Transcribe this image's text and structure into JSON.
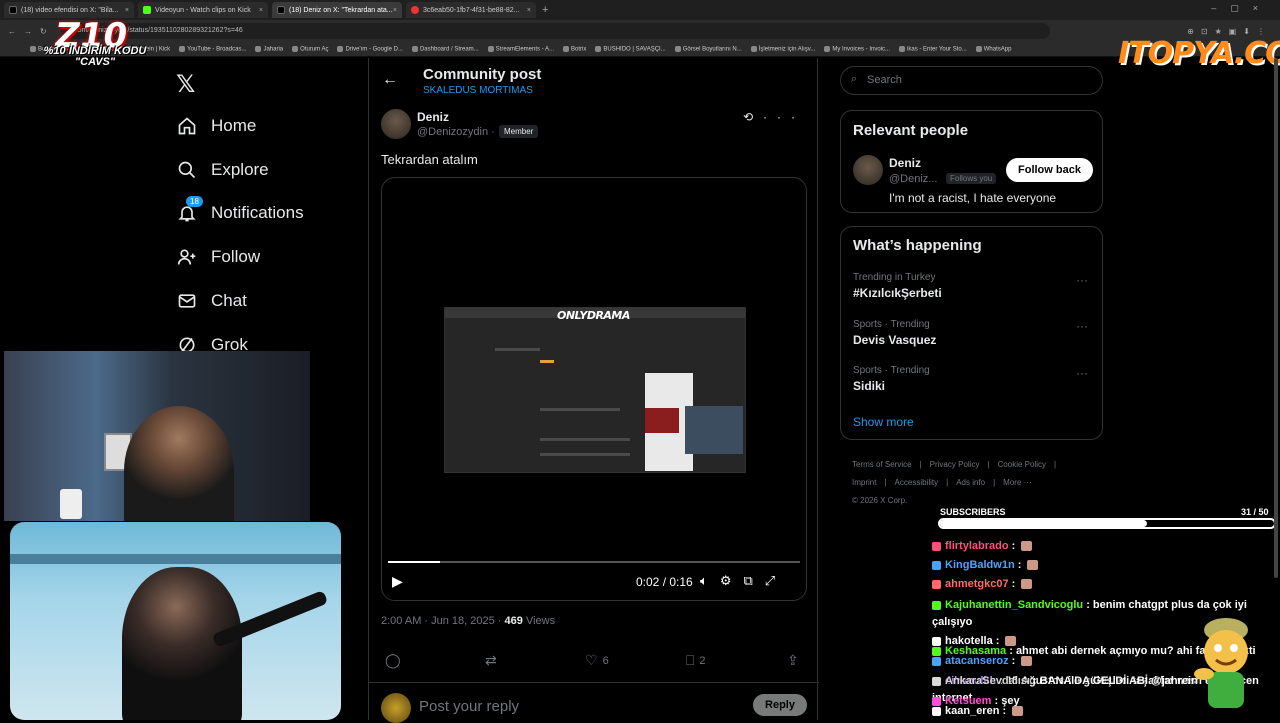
{
  "browser": {
    "tabs": [
      {
        "label": "(18) video efendisi on X: \"Bila...",
        "color": "#000000"
      },
      {
        "label": "Videoyun - Watch clips on Kick",
        "color": "#53fc18"
      },
      {
        "label": "(18) Deniz on X: \"Tekrardan ata...",
        "color": "#000000"
      },
      {
        "label": "3c6eab50-1fb7-4f31-be88-82...",
        "color": "#e33"
      }
    ],
    "url": "x.com/Denizozydin/status/1935110280289321262?s=46",
    "bookmarks": [
      "Bookmarks",
      "Gözat | Kick",
      "Jahrein | Kick",
      "YouTube - Broadcas...",
      "Jaharia",
      "Oturum Aç",
      "Drive'ım - Google D...",
      "Dashboard / Stream...",
      "StreamElements - A...",
      "Botrix",
      "BUSHIDO | SAVAŞÇI...",
      "Görsel Boyutlarını N...",
      "İşletmeniz için Alışv...",
      "My Invoices - Invoic...",
      "ikas - Enter Your Sto...",
      "WhatsApp"
    ]
  },
  "overlay": {
    "logo": "Z10",
    "promo_line1": "%10 İNDİRİM KODU",
    "promo_line2": "\"CAVS\"",
    "sponsor": "ITOPYA.COM"
  },
  "sidebar": {
    "logo": "𝕏",
    "items": [
      {
        "label": "Home",
        "icon": "home-icon"
      },
      {
        "label": "Explore",
        "icon": "search-icon"
      },
      {
        "label": "Notifications",
        "icon": "bell-icon",
        "badge": "18"
      },
      {
        "label": "Follow",
        "icon": "person-add-icon"
      },
      {
        "label": "Chat",
        "icon": "mail-icon"
      },
      {
        "label": "Grok",
        "icon": "grok-icon"
      }
    ]
  },
  "post": {
    "header_title": "Community post",
    "header_subtitle": "SKALEDUS MORTIMAS",
    "author_name": "Deniz",
    "author_handle": "@Denizozydin ·",
    "author_role": "Member",
    "text": "Tekrardan atalım",
    "video": {
      "overlay_title": "ONLYDRAMA",
      "time": "0:02 / 0:16",
      "progress": 0.125
    },
    "time": "2:00 AM · Jun 18, 2025 ·",
    "views": "469",
    "views_label": "Views",
    "likes": "6",
    "bookmarks": "2",
    "reply_placeholder": "Post your reply",
    "reply_button": "Reply"
  },
  "right": {
    "search_placeholder": "Search",
    "relevant_title": "Relevant people",
    "person": {
      "name": "Deniz",
      "handle": "@Deniz...",
      "follows_you": "Follows you",
      "button": "Follow back",
      "bio": "I'm not a racist, I hate everyone"
    },
    "happening_title": "What’s happening",
    "trends": [
      {
        "category": "Trending in Turkey",
        "name": "#KızılcıkŞerbeti"
      },
      {
        "category": "Sports · Trending",
        "name": "Devis Vasquez"
      },
      {
        "category": "Sports · Trending",
        "name": "Sidiki"
      }
    ],
    "show_more": "Show more",
    "footer_links": [
      "Terms of Service",
      "|",
      "Privacy Policy",
      "|",
      "Cookie Policy",
      "|",
      "Imprint",
      "|",
      "Accessibility",
      "|",
      "Ads info",
      "|",
      "More ···"
    ],
    "copyright": "© 2026 X Corp."
  },
  "stream": {
    "subs_label": "SUBSCRIBERS",
    "subs_count": "31 / 50",
    "subs_progress": 0.62,
    "chat": [
      {
        "user": "flirtylabrado",
        "color": "#ff4f7b",
        "msg": ""
      },
      {
        "user": "KingBaldw1n",
        "color": "#4aa3ff",
        "msg": ""
      },
      {
        "user": "ahmetgkc07",
        "color": "#ff6b6b",
        "msg": ""
      },
      {
        "user": "Kajuhanettin_Sandvicoglu",
        "color": "#53fc18",
        "msg": "benim chatgpt plus da çok iyi çalışıyo"
      },
      {
        "user": "hakotella",
        "color": "#ffffff",
        "msg": ""
      },
      {
        "user": "Keshasama",
        "color": "#53fc18",
        "msg": "ahmet abi dernek açmıyo mu? ahi fati acicakti"
      },
      {
        "user": "atacanseroz",
        "color": "#4aa3ff",
        "msg": ""
      },
      {
        "user": "cihanulkh",
        "color": "#b98cff",
        "msg": "15 Ağustos ile gülüşleri taşaklar nasıl engellicen internet"
      },
      {
        "user": "AnkaraSevdalısı",
        "color": "#d8d8d8",
        "msg": "BANA DA GELDİ ABİ @jahrein"
      },
      {
        "user": "Ketsuem",
        "color": "#ff4fd8",
        "msg": "şey"
      },
      {
        "user": "kaan_eren",
        "color": "#ffffff",
        "msg": ""
      }
    ]
  }
}
